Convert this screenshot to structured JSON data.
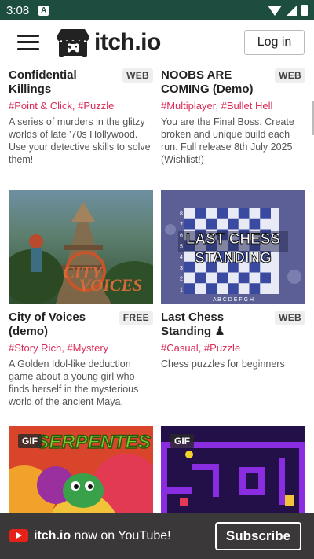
{
  "statusbar": {
    "time": "3:08",
    "notif_letter": "A"
  },
  "header": {
    "logo_text": "itch.io",
    "login_label": "Log in"
  },
  "games": [
    {
      "title": "Confidential Killings",
      "platform": "WEB",
      "tags": "#Point & Click, #Puzzle",
      "description": "A series of murders in the glitzy worlds of late '70s Hollywood. Use your detective skills to solve them!"
    },
    {
      "title": "NOOBS ARE COMING (Demo)",
      "platform": "WEB",
      "tags": "#Multiplayer, #Bullet Hell",
      "description": "You are the Final Boss. Create broken and unique build each run. Full release 8th July 2025 (Wishlist!)"
    },
    {
      "title": "City of Voices (demo)",
      "platform": "FREE",
      "tags": "#Story Rich, #Mystery",
      "description": "A Golden Idol-like deduction game about a young girl who finds herself in the mysterious world of the ancient Maya.",
      "art_text": "CITY OF VOICES"
    },
    {
      "title": "Last Chess Standing ♟",
      "platform": "WEB",
      "tags": "#Casual, #Puzzle",
      "description": "Chess puzzles for beginners",
      "art_text_1": "LAST CHESS",
      "art_text_2": "STANDING",
      "ranks": [
        "8",
        "7",
        "6",
        "5",
        "4",
        "3",
        "2",
        "1"
      ],
      "files": "A B C D E F G H"
    },
    {
      "gif_label": "GIF",
      "art_text": "SERPENTES"
    },
    {
      "gif_label": "GIF"
    }
  ],
  "youtube_bar": {
    "brand": "itch.io",
    "text": " now on YouTube!",
    "subscribe_label": "Subscribe"
  },
  "colors": {
    "status_bar": "#1d4d3f",
    "tag": "#da2c57",
    "youtube_red": "#e62117",
    "banner_bg": "#3a3838"
  }
}
